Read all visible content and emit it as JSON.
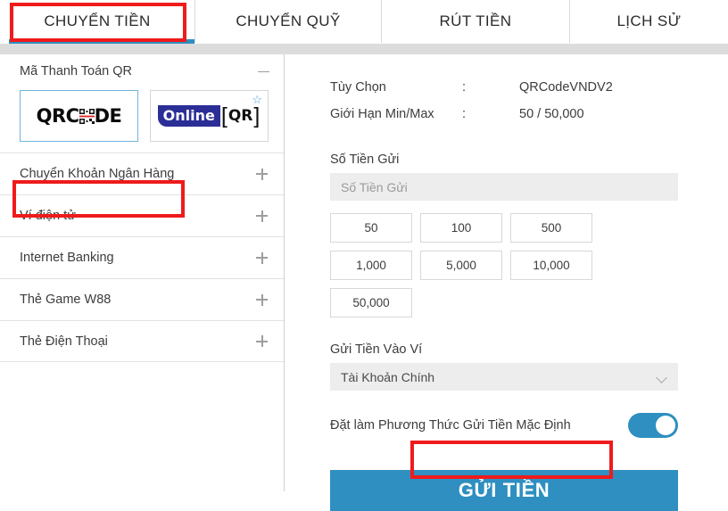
{
  "tabs": [
    {
      "label": "CHUYỂN TIỀN",
      "active": true
    },
    {
      "label": "CHUYỂN QUỸ",
      "active": false
    },
    {
      "label": "RÚT TIỀN",
      "active": false
    },
    {
      "label": "LỊCH SỬ",
      "active": false
    }
  ],
  "sidebar": {
    "qr_section": {
      "title": "Mã Thanh Toán QR",
      "collapse_icon": "minus-icon",
      "logos": [
        {
          "name": "QRCODE",
          "text_left": "QRC",
          "text_right": "DE",
          "selected": true,
          "favorite": false
        },
        {
          "name": "Online QR",
          "text_blue": "Online",
          "text_qr": "QR",
          "selected": false,
          "favorite": true
        }
      ]
    },
    "items": [
      {
        "label": "Chuyển Khoản Ngân Hàng",
        "expand_icon": "plus-icon"
      },
      {
        "label": "Ví điện tử",
        "expand_icon": "plus-icon"
      },
      {
        "label": "Internet Banking",
        "expand_icon": "plus-icon"
      },
      {
        "label": "Thẻ Game W88",
        "expand_icon": "plus-icon"
      },
      {
        "label": "Thẻ Điện Thoại",
        "expand_icon": "plus-icon"
      }
    ]
  },
  "panel": {
    "info_rows": [
      {
        "label": "Tùy Chọn",
        "separator": ":",
        "value": "QRCodeVNDV2"
      },
      {
        "label": "Giới Hạn Min/Max",
        "separator": ":",
        "value": "50 / 50,000"
      }
    ],
    "amount_field": {
      "label": "Số Tiền Gửi",
      "placeholder": "Số Tiền Gửi",
      "value": ""
    },
    "quick_amounts": [
      "50",
      "100",
      "500",
      "1,000",
      "5,000",
      "10,000",
      "50,000"
    ],
    "wallet_field": {
      "label": "Gửi Tiền Vào Ví",
      "selected": "Tài Khoản Chính",
      "chevron_icon": "chevron-down-icon"
    },
    "default_toggle": {
      "label": "Đặt làm Phương Thức Gửi Tiền Mặc Định",
      "state": "on"
    },
    "submit_label": "GỬI TIỀN"
  },
  "colors": {
    "accent_blue": "#2e8fc0",
    "annotation_red": "#ef1b1b",
    "logo_blue": "#2b2e96",
    "input_bg": "#ededed"
  }
}
